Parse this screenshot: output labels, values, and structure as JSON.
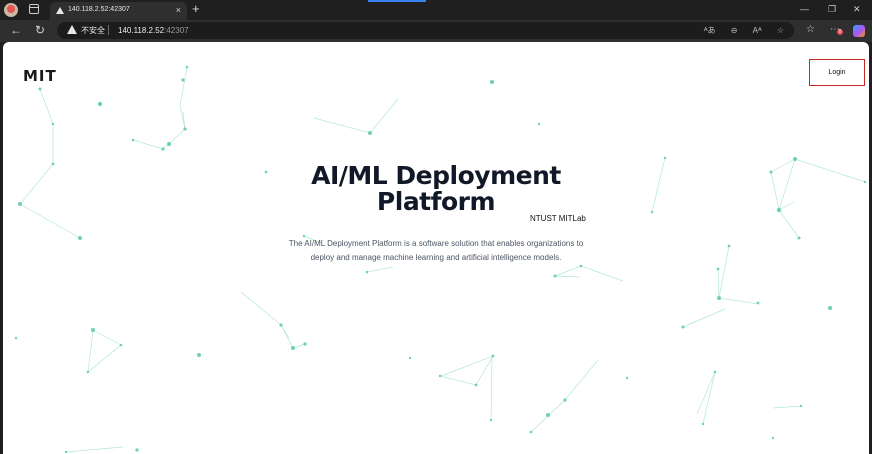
{
  "browser": {
    "tab": {
      "title": "140.118.2.52:42307",
      "close_glyph": "×"
    },
    "new_tab_glyph": "+",
    "window_controls": {
      "minimize": "—",
      "restore": "❐",
      "close": "✕"
    },
    "address_bar": {
      "security_label": "不安全",
      "url_host": "140.118.2.52",
      "url_port": ":42307"
    },
    "notification_count": "0",
    "icons": {
      "back": "back-arrow-icon",
      "reload": "reload-icon",
      "warning": "warning-icon",
      "read_aloud": "read-aloud-icon",
      "zoom": "zoom-icon",
      "favorite": "favorite-star-icon",
      "collections": "collections-icon",
      "extensions": "extensions-icon",
      "copilot": "copilot-icon"
    }
  },
  "page": {
    "logo": "MIT",
    "login_label": "Login",
    "title": "AI/ML Deployment Platform",
    "byline": "NTUST MITLab",
    "description": "The AI/ML Deployment Platform is a software solution that enables organizations to deploy and manage machine learning and artificial intelligence models."
  },
  "colors": {
    "accent_node": "#6fd3a8",
    "login_border": "#c62828",
    "title": "#111827"
  }
}
